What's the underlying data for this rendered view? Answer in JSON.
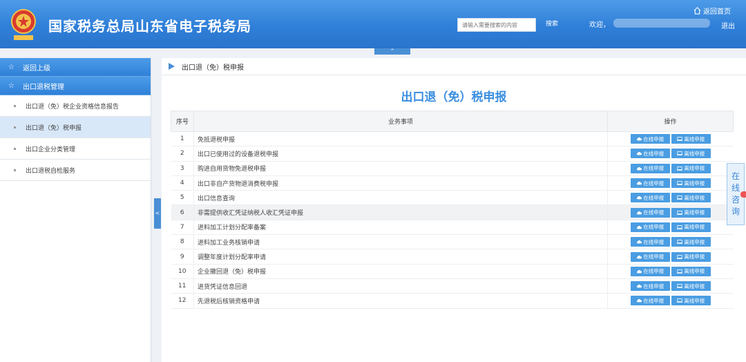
{
  "header": {
    "site_title": "国家税务总局山东省电子税务局",
    "search_placeholder": "请输入需要搜索的内容",
    "search_label": "搜索",
    "welcome": "欢迎，",
    "home_label": "返回首页",
    "logout_label": "退出",
    "collapse_label": "^"
  },
  "sidebar": {
    "back_label": "返回上级",
    "section_label": "出口退税管理",
    "items": [
      {
        "label": "出口退（免）税企业资格信息报告",
        "active": false
      },
      {
        "label": "出口退（免）税申报",
        "active": true
      },
      {
        "label": "出口企业分类管理",
        "active": false
      },
      {
        "label": "出口退税自检服务",
        "active": false
      }
    ],
    "collapse_label": "<"
  },
  "main": {
    "breadcrumb": "出口退（免）税申报",
    "title": "出口退（免）税申报",
    "columns": [
      "序号",
      "业务事项",
      "操作"
    ],
    "online_btn": "在线申报",
    "offline_btn": "离线申报",
    "rows": [
      {
        "num": "1",
        "task": "免抵退税申报"
      },
      {
        "num": "2",
        "task": "出口已使用过的设备退税申报"
      },
      {
        "num": "3",
        "task": "购进自用货物免退税申报"
      },
      {
        "num": "4",
        "task": "出口非自产货物退消费税申报"
      },
      {
        "num": "5",
        "task": "出口信息查询"
      },
      {
        "num": "6",
        "task": "非需提供收汇凭证纳税人收汇凭证申报"
      },
      {
        "num": "7",
        "task": "进料加工计划分配率备案"
      },
      {
        "num": "8",
        "task": "进料加工业务核销申请"
      },
      {
        "num": "9",
        "task": "调整年度计划分配率申请"
      },
      {
        "num": "10",
        "task": "企业撤回退（免）税申报"
      },
      {
        "num": "11",
        "task": "进货凭证信息回退"
      },
      {
        "num": "12",
        "task": "先退税后核销资格申请"
      }
    ]
  },
  "consult": {
    "chars": [
      "在",
      "线",
      "咨",
      "询"
    ]
  },
  "colors": {
    "primary": "#2f80d8",
    "accent": "#4a9de2",
    "title": "#3a8ee0"
  }
}
